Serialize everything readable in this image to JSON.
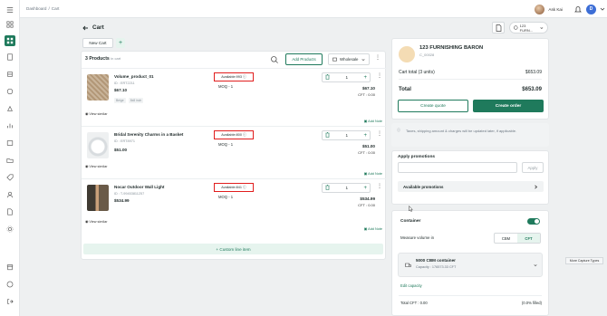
{
  "breadcrumb": {
    "root": "Dashboard",
    "separator": "/",
    "current": "Cart"
  },
  "user": {
    "name": "Ask Kai",
    "initial": "D"
  },
  "page": {
    "title": "Cart"
  },
  "store_selector": {
    "label": "123 FURN..."
  },
  "tabs": [
    {
      "label": "New Cart"
    }
  ],
  "cart": {
    "count_label": "3 Products",
    "count_sub": "in cart",
    "add_products": "Add Products",
    "price_list": "Wholesale",
    "items": [
      {
        "name": "Volume_product_01",
        "id": "ID : ERT2211",
        "price": "$67.10",
        "chips": [
          "Beige",
          "8x8 inch"
        ],
        "availability": "Available:993",
        "moq": "MOQ - 1",
        "qty": "1",
        "total": "$67.10",
        "cft": "CFT : 0.00",
        "view_similar": "View similar",
        "add_note": "Add Note"
      },
      {
        "name": "Bridal Serenity Charms in a Basket",
        "id": "ID : ERT8971",
        "price": "$51.00",
        "chips": [],
        "availability": "Available:800",
        "moq": "MOQ - 1",
        "qty": "1",
        "total": "$51.00",
        "cft": "CFT : 0.00",
        "view_similar": "View similar",
        "add_note": "Add Note"
      },
      {
        "name": "Nocar Outdoor Wall Light",
        "id": "ID : T-99453811257",
        "price": "$534.99",
        "chips": [],
        "availability": "Available:841",
        "moq": "MOQ - 1",
        "qty": "1",
        "total": "$534.99",
        "cft": "CFT : 0.00",
        "view_similar": "View similar",
        "add_note": "Add Note"
      }
    ],
    "custom_line": "Custom line item"
  },
  "summary": {
    "store_name": "123 FURNISHING BARON",
    "store_code": "C_00028",
    "cart_total_label": "Cart total (3 units)",
    "cart_total_value": "$653.09",
    "total_label": "Total",
    "total_value": "$653.09",
    "create_quote": "Create quote",
    "create_order": "Create order"
  },
  "info_note": "Taxes, shipping amount & charges will be updated later, if applicable.",
  "promotions": {
    "title": "Apply promotions",
    "apply": "Apply",
    "available": "Available promotions"
  },
  "container": {
    "title": "Container",
    "measure_label": "Measure volume in",
    "units": [
      "CBM",
      "CFT"
    ],
    "selected_unit": "CFT",
    "name": "5000 CBM container",
    "capacity": "Capacity : 176573.33 CFT",
    "edit_capacity": "Edit capacity",
    "total_cft_label": "Total CFT : 0.00",
    "filled": "(0.0% filled)"
  },
  "tooltip": "More Capture Types",
  "colors": {
    "accent": "#1f7a5c",
    "highlight": "#e11d1d",
    "badge": "#3d6ed6"
  }
}
